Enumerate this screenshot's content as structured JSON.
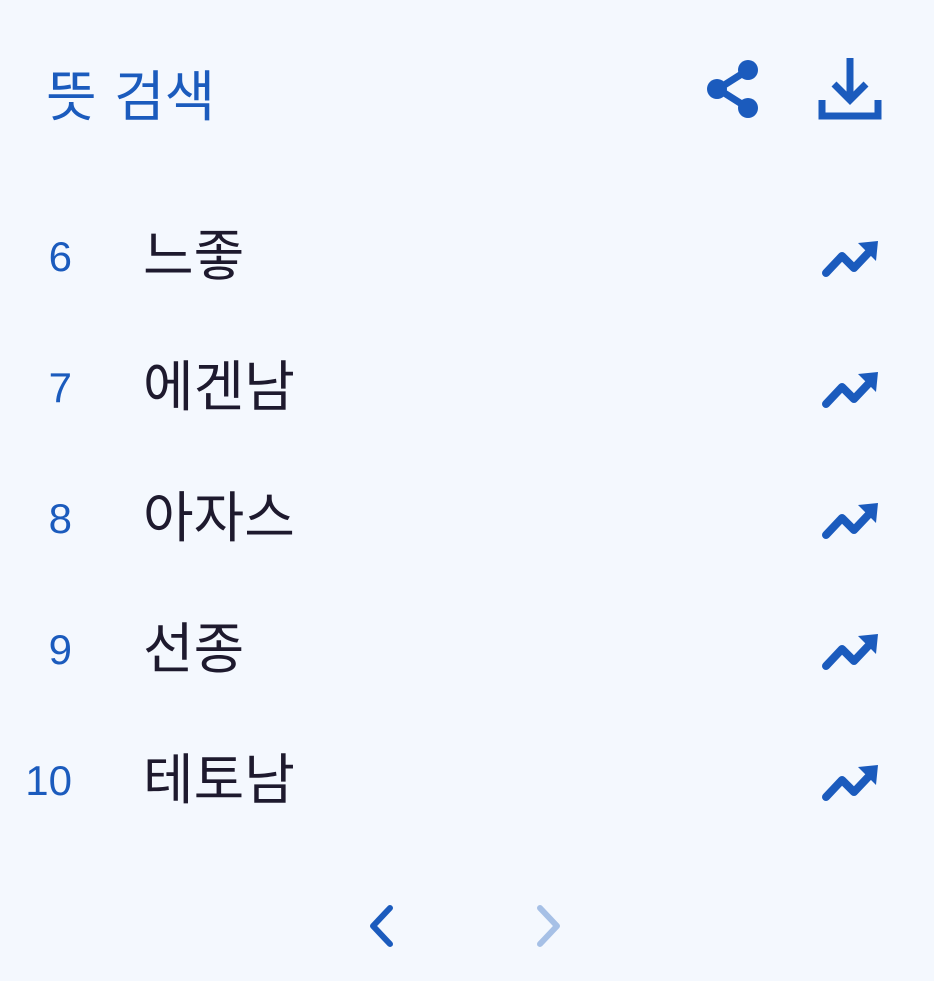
{
  "header": {
    "title": "뜻 검색",
    "share_icon": "share-icon",
    "download_icon": "download-icon"
  },
  "colors": {
    "accent": "#1b5bbd",
    "text": "#1e1a2e",
    "background": "#f4f8fe",
    "disabled": "#a6c0e6"
  },
  "items": [
    {
      "rank": "6",
      "term": "느좋",
      "icon": "trending-up-icon"
    },
    {
      "rank": "7",
      "term": "에겐남",
      "icon": "trending-up-icon"
    },
    {
      "rank": "8",
      "term": "아자스",
      "icon": "trending-up-icon"
    },
    {
      "rank": "9",
      "term": "선종",
      "icon": "trending-up-icon"
    },
    {
      "rank": "10",
      "term": "테토남",
      "icon": "trending-up-icon"
    }
  ],
  "pagination": {
    "prev_icon": "chevron-left-icon",
    "next_icon": "chevron-right-icon"
  }
}
